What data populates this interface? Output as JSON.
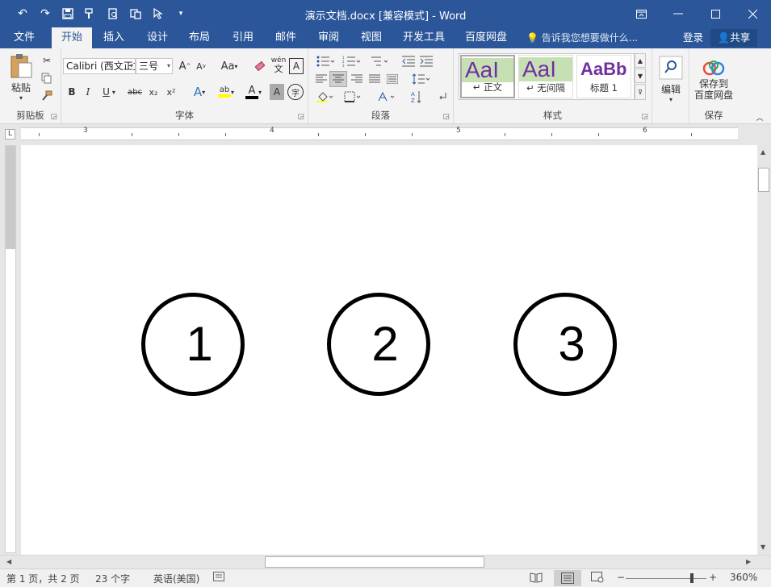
{
  "window": {
    "title": "演示文档.docx [兼容模式] - Word",
    "controls": [
      "ribbon-display-options",
      "minimize",
      "maximize",
      "close"
    ]
  },
  "quick_access": [
    "undo",
    "redo",
    "save",
    "format-painter",
    "print-preview",
    "touch-mode",
    "customize"
  ],
  "tabs": [
    {
      "label": "文件",
      "active": false
    },
    {
      "label": "开始",
      "active": true
    },
    {
      "label": "插入",
      "active": false
    },
    {
      "label": "设计",
      "active": false
    },
    {
      "label": "布局",
      "active": false
    },
    {
      "label": "引用",
      "active": false
    },
    {
      "label": "邮件",
      "active": false
    },
    {
      "label": "审阅",
      "active": false
    },
    {
      "label": "视图",
      "active": false
    },
    {
      "label": "开发工具",
      "active": false
    },
    {
      "label": "百度网盘",
      "active": false
    }
  ],
  "tell_me": "告诉我您想要做什么...",
  "account": {
    "login": "登录",
    "share": "共享"
  },
  "ribbon": {
    "clipboard": {
      "label": "剪贴板",
      "paste": "粘贴"
    },
    "font": {
      "label": "字体",
      "font_name": "Calibri (西文正文)",
      "font_size": "三号",
      "pinyin": "wén",
      "pinyin_char": "文",
      "border_char": "A",
      "grow": "A",
      "shrink": "A",
      "change_case": "Aa",
      "bold": "B",
      "italic": "I",
      "underline": "U",
      "strike": "abc",
      "subscript": "x₂",
      "superscript": "x²",
      "text_effects": "A",
      "highlight": "ab",
      "font_color": "A",
      "char_shading": "A",
      "enclose": "字"
    },
    "paragraph": {
      "label": "段落"
    },
    "styles": {
      "label": "样式",
      "items": [
        {
          "sample": "AaI",
          "name": "正文"
        },
        {
          "sample": "AaI",
          "name": "无间隔"
        },
        {
          "sample": "AaBb",
          "name": "标题 1"
        }
      ]
    },
    "editing": {
      "label": "编辑"
    },
    "save": {
      "label": "保存",
      "button_line1": "保存到",
      "button_line2": "百度网盘"
    }
  },
  "ruler": {
    "numbers": [
      "3",
      "4",
      "5",
      "6"
    ],
    "corner": "L"
  },
  "document": {
    "circles": [
      "1",
      "2",
      "3"
    ]
  },
  "status": {
    "page": "第 1 页，共 2 页",
    "words": "23 个字",
    "language": "英语(美国)",
    "zoom": "360%",
    "zoom_level": 0.8
  }
}
